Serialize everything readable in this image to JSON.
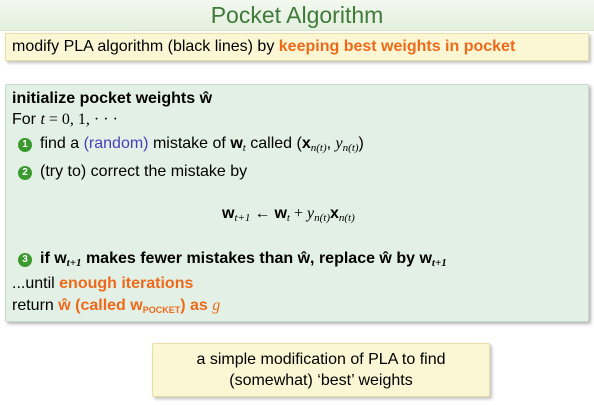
{
  "title": "Pocket Algorithm",
  "banner": {
    "prefix": "modify PLA algorithm (black lines) by ",
    "highlight": "keeping best weights in pocket"
  },
  "algorithm": {
    "init": "initialize pocket weights ŵ",
    "for_prefix": "For ",
    "for_t": "t",
    "for_rest": " = 0, 1, · · ·",
    "step1": {
      "number": "1",
      "text_a": "find a ",
      "random": "(random)",
      "text_b": " mistake of ",
      "w": "w",
      "w_sub": "t",
      "text_c": " called (",
      "x": "x",
      "x_sub": "n(t)",
      "comma": ", ",
      "y": "y",
      "y_sub": "n(t)",
      "close": ")"
    },
    "step2": {
      "number": "2",
      "text": "(try to) correct the mistake by"
    },
    "update": {
      "w_left": "w",
      "w_left_sub": "t+1",
      "arrow": " ← ",
      "w_right": "w",
      "w_right_sub": "t",
      "plus": " + ",
      "y": "y",
      "y_sub": "n(t)",
      "x": "x",
      "x_sub": "n(t)"
    },
    "step3": {
      "number": "3",
      "text_a": "if ",
      "w": "w",
      "w_sub": "t+1",
      "text_b": " makes fewer mistakes than ŵ, replace ŵ by ",
      "w2": "w",
      "w2_sub": "t+1"
    },
    "until_prefix": "...until ",
    "until_highlight": "enough iterations",
    "return_prefix": "return ",
    "return_highlight_a": "ŵ (called ",
    "return_w": "w",
    "return_w_sub": "POCKET",
    "return_highlight_b": ") as ",
    "return_g": "g"
  },
  "footer": {
    "line1": "a simple modification of PLA to find",
    "line2": "(somewhat) ‘best’ weights"
  },
  "colors": {
    "title": "#3f7a3a",
    "highlight": "#ee6a1a",
    "random": "#4b3fb7",
    "step_badge": "#3a9a2e",
    "main_box": "#e3f0e6",
    "note_box": "#fbf7d4"
  }
}
